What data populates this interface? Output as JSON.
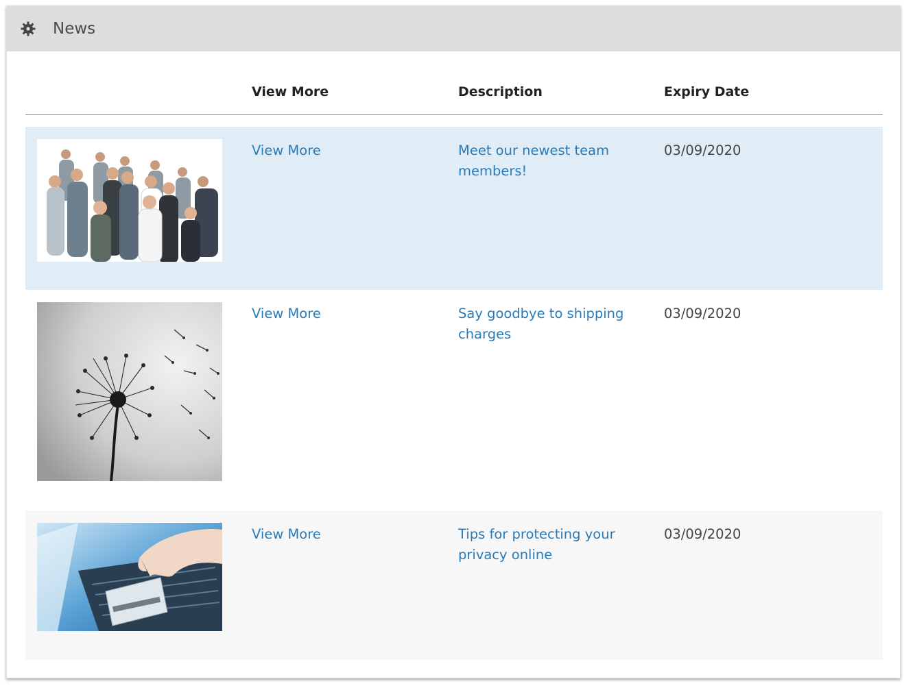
{
  "header": {
    "icon": "gear-icon",
    "title": "News"
  },
  "columns": [
    "",
    "View More",
    "Description",
    "Expiry Date"
  ],
  "rows": [
    {
      "image": "team-photo",
      "view_more": "View More",
      "description": "Meet our newest team members!",
      "expiry": "03/09/2020"
    },
    {
      "image": "dandelion-photo",
      "view_more": "View More",
      "description": "Say goodbye to shipping charges",
      "expiry": "03/09/2020"
    },
    {
      "image": "laptop-card-photo",
      "view_more": "View More",
      "description": "Tips for protecting your privacy online",
      "expiry": "03/09/2020"
    }
  ],
  "colors": {
    "header_bg": "#dddddd",
    "row_selected": "#e1edf6",
    "row_alt": "#f7f7f7",
    "link": "#2a7ab8"
  }
}
